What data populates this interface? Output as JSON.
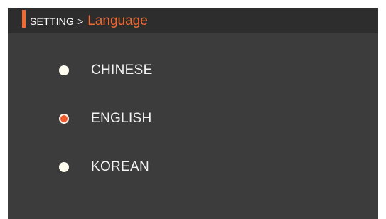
{
  "header": {
    "root": "SETTING",
    "separator": ">",
    "current": "Language"
  },
  "options": [
    {
      "label": "CHINESE",
      "selected": false
    },
    {
      "label": "ENGLISH",
      "selected": true
    },
    {
      "label": "KOREAN",
      "selected": false
    }
  ],
  "colors": {
    "accent": "#f06a33",
    "background": "#3c3c3c",
    "header_background": "#2d2d2d",
    "text": "#f4f4f4"
  }
}
